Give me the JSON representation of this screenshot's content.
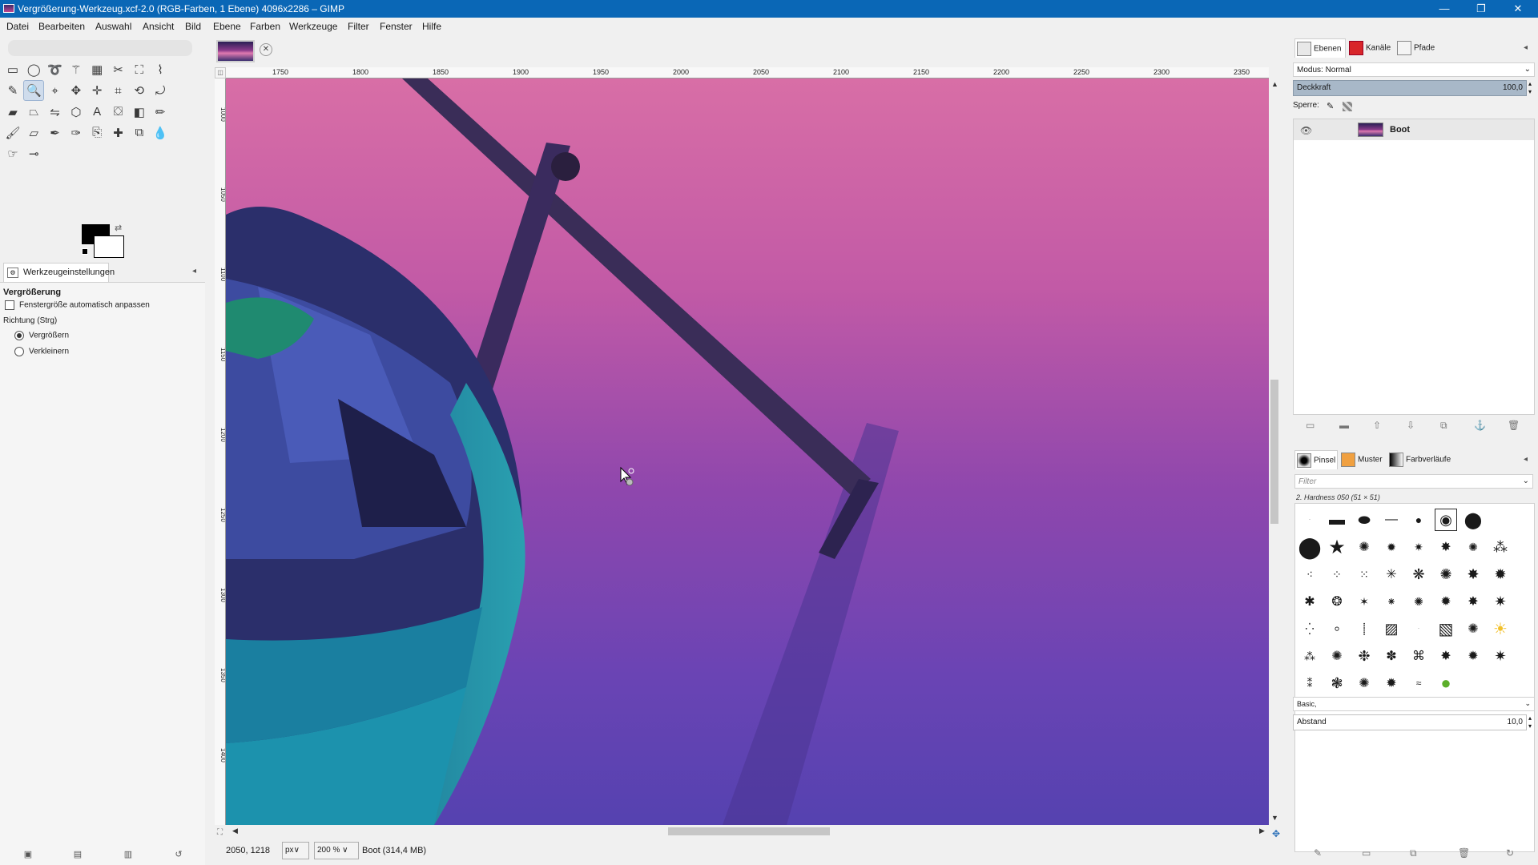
{
  "window": {
    "title": "Vergrößerung-Werkzeug.xcf-2.0 (RGB-Farben, 1 Ebene) 4096x2286 – GIMP",
    "minimize": "—",
    "restore": "❐",
    "close": "✕"
  },
  "menu": [
    "Datei",
    "Bearbeiten",
    "Auswahl",
    "Ansicht",
    "Bild",
    "Ebene",
    "Farben",
    "Werkzeuge",
    "Filter",
    "Fenster",
    "Hilfe"
  ],
  "toolbox": {
    "tools": [
      {
        "name": "rect-select-icon",
        "glyph": "▭"
      },
      {
        "name": "ellipse-select-icon",
        "glyph": "◯"
      },
      {
        "name": "free-select-icon",
        "glyph": "➰"
      },
      {
        "name": "fuzzy-select-icon",
        "glyph": "⚚"
      },
      {
        "name": "select-by-color-icon",
        "glyph": "▦"
      },
      {
        "name": "scissors-select-icon",
        "glyph": "✂"
      },
      {
        "name": "foreground-select-icon",
        "glyph": "⛶"
      },
      {
        "name": "paths-icon",
        "glyph": "⌇"
      },
      {
        "name": "color-picker-icon",
        "glyph": "✎"
      },
      {
        "name": "zoom-icon",
        "glyph": "🔍"
      },
      {
        "name": "measure-icon",
        "glyph": "⌖"
      },
      {
        "name": "move-icon",
        "glyph": "✥"
      },
      {
        "name": "align-icon",
        "glyph": "✛"
      },
      {
        "name": "crop-icon",
        "glyph": "⌗"
      },
      {
        "name": "unified-transform-icon",
        "glyph": "⟲"
      },
      {
        "name": "rotate-icon",
        "glyph": "⤾"
      },
      {
        "name": "shear-icon",
        "glyph": "▰"
      },
      {
        "name": "perspective-icon",
        "glyph": "⏢"
      },
      {
        "name": "flip-icon",
        "glyph": "⇋"
      },
      {
        "name": "cage-icon",
        "glyph": "⬡"
      },
      {
        "name": "text-icon",
        "glyph": "A"
      },
      {
        "name": "bucket-fill-icon",
        "glyph": "⛋"
      },
      {
        "name": "gradient-icon",
        "glyph": "◧"
      },
      {
        "name": "pencil-icon",
        "glyph": "✏"
      },
      {
        "name": "paintbrush-icon",
        "glyph": "🖌"
      },
      {
        "name": "eraser-icon",
        "glyph": "▱"
      },
      {
        "name": "airbrush-icon",
        "glyph": "✒"
      },
      {
        "name": "ink-icon",
        "glyph": "✑"
      },
      {
        "name": "clone-icon",
        "glyph": "⎘"
      },
      {
        "name": "heal-icon",
        "glyph": "✚"
      },
      {
        "name": "perspective-clone-icon",
        "glyph": "⧉"
      },
      {
        "name": "blur-icon",
        "glyph": "💧"
      },
      {
        "name": "smudge-icon",
        "glyph": "☞"
      },
      {
        "name": "dodge-burn-icon",
        "glyph": "⊸"
      }
    ],
    "active_tool": "zoom-icon",
    "colors": {
      "foreground": "#000000",
      "background": "#ffffff"
    }
  },
  "tool_options": {
    "tab_label": "Werkzeugeinstellungen",
    "heading": "Vergrößerung",
    "auto_resize_label": "Fenstergröße automatisch anpassen",
    "auto_resize_checked": false,
    "direction_label": "Richtung (Strg)",
    "zoom_in_label": "Vergrößern",
    "zoom_out_label": "Verkleinern",
    "direction_selected": "Vergrößern"
  },
  "rulers": {
    "horizontal_ticks": [
      "1750",
      "1800",
      "1850",
      "1900",
      "1950",
      "2000",
      "2050",
      "2100",
      "2150",
      "2200",
      "2250",
      "2300",
      "2350"
    ],
    "vertical_ticks": [
      "1000",
      "1050",
      "1100",
      "1150",
      "1200",
      "1250",
      "1300",
      "1350",
      "1400"
    ]
  },
  "status": {
    "pointer_coords": "2050, 1218",
    "unit": "px",
    "zoom": "200 %",
    "image_info": "Boot (314,4 MB)"
  },
  "dock": {
    "tabs_top": [
      "Ebenen",
      "Kanäle",
      "Pfade"
    ],
    "mode_label": "Modus: Normal",
    "opacity_label": "Deckkraft",
    "opacity_value": "100,0",
    "lock_label": "Sperre:",
    "layer_name": "Boot",
    "tabs_bottom": [
      "Pinsel",
      "Muster",
      "Farbverläufe"
    ],
    "filter_placeholder": "Filter",
    "selected_brush": "2. Hardness 050 (51 × 51)",
    "brush_preset": "Basic,",
    "spacing_label": "Abstand",
    "spacing_value": "10,0"
  }
}
